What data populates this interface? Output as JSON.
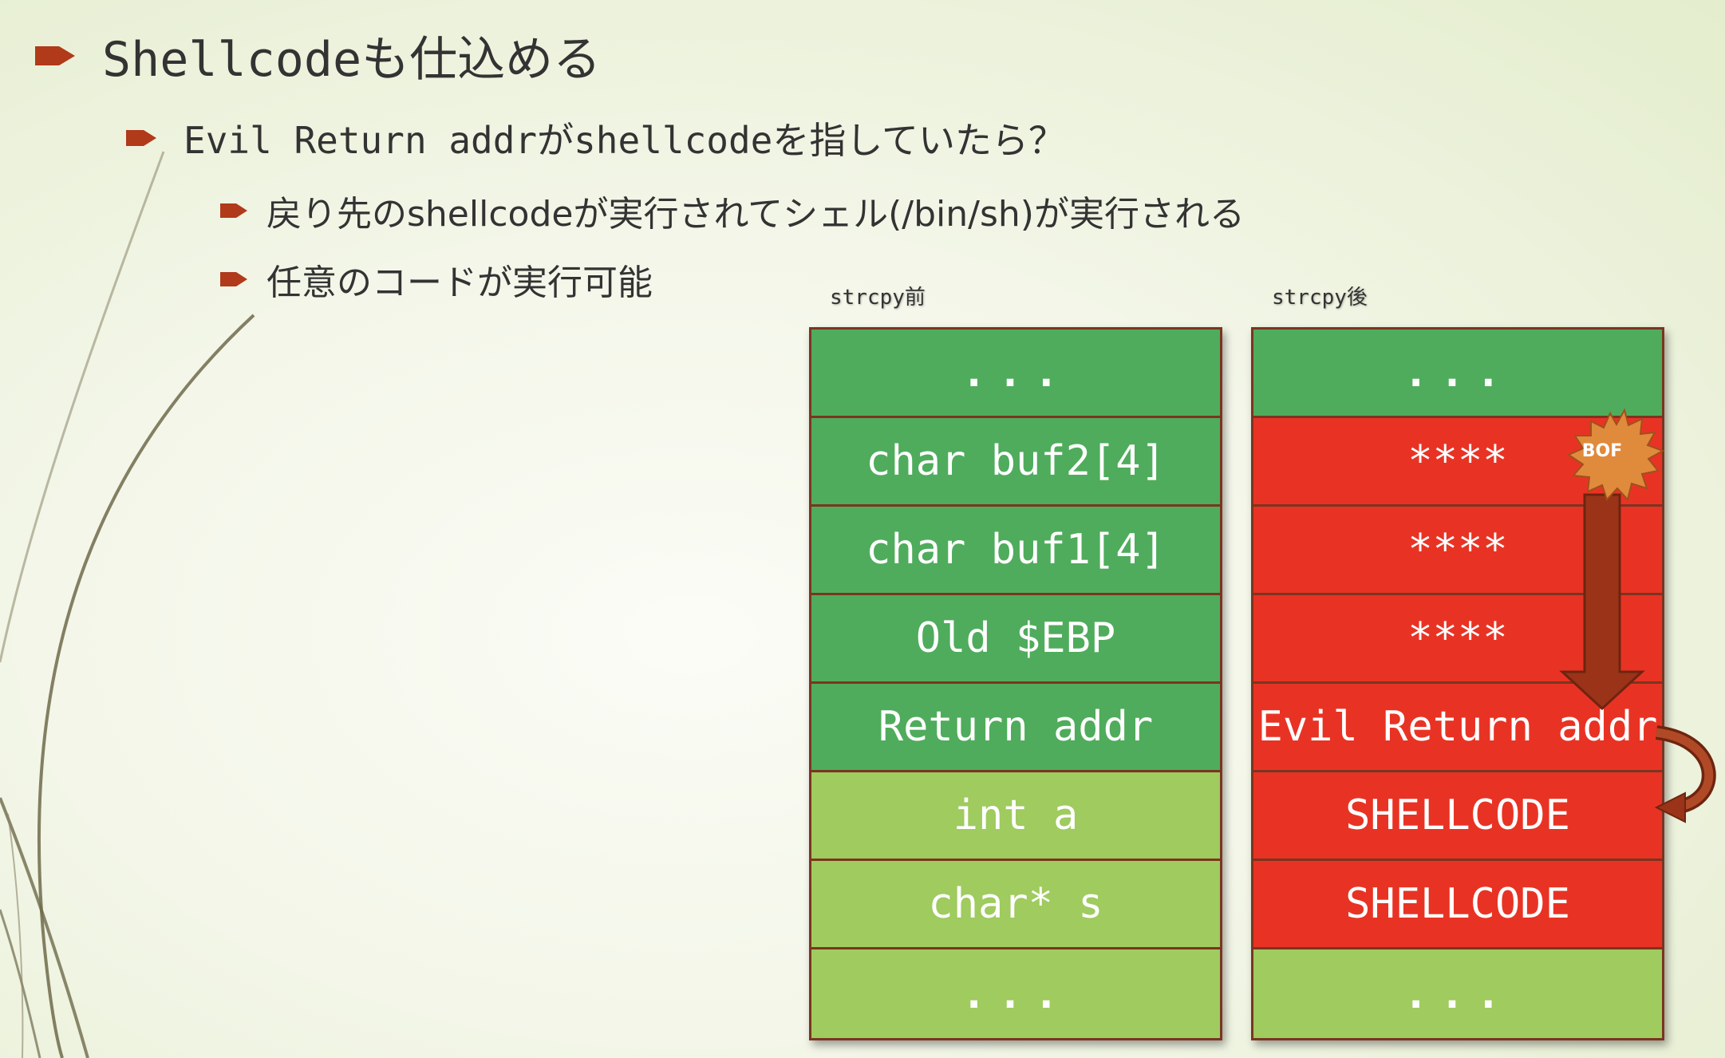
{
  "colors": {
    "bullet": "#b03a1a",
    "stack_green_dark": "#4fac5c",
    "stack_green_light": "#9fcb5f",
    "stack_red": "#e83324",
    "border": "#7a3520",
    "arrow": "#9a3318"
  },
  "bullets": {
    "level1": "Shellcodeも仕込める",
    "level2": "Evil Return addrがshellcodeを指していたら？",
    "level3": [
      "戻り先のshellcodeが実行されてシェル(/bin/sh)が実行される",
      "任意のコードが実行可能"
    ]
  },
  "diagram": {
    "before": {
      "label": "strcpy前",
      "cells": [
        "...",
        "char buf2[4]",
        "char buf1[4]",
        "Old $EBP",
        "Return addr",
        "int a",
        "char* s",
        "..."
      ]
    },
    "after": {
      "label": "strcpy後",
      "cells": [
        "...",
        "****",
        "****",
        "****",
        "Evil Return addr",
        "SHELLCODE",
        "SHELLCODE",
        "..."
      ]
    },
    "burst_label": "BOF"
  }
}
